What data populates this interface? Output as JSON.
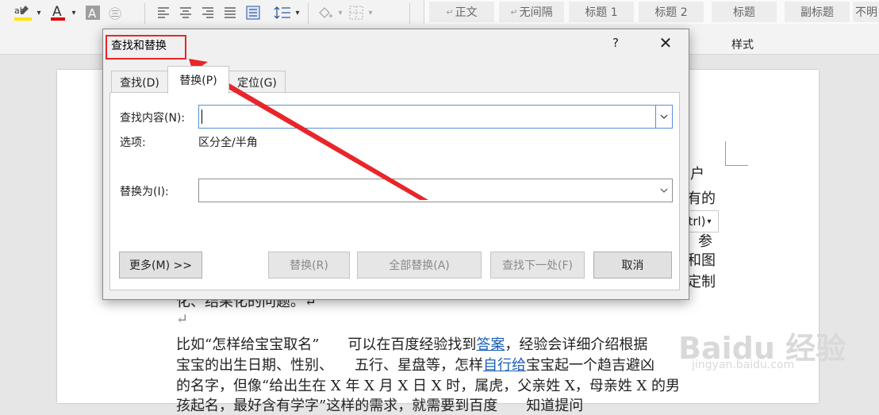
{
  "ribbon": {
    "styles": [
      "正文",
      "无间隔",
      "标题 1",
      "标题 2",
      "标题",
      "副标题",
      "不明"
    ],
    "styles_group_label": "样式",
    "handwriting_glyph": "㊂"
  },
  "document": {
    "lines": [
      {
        "text": "户"
      },
      {
        "text": "有的"
      },
      {
        "text": "参"
      },
      {
        "text": "和图"
      },
      {
        "text": "定制"
      },
      {
        "text": "化、结果化的问题。↵"
      },
      {
        "text": "↵"
      },
      {
        "pre": "比如“怎样给宝宝取名”　　可以在百度经验找到",
        "link": "答案",
        "post": "，经验会详细介绍根据"
      },
      {
        "pre": "宝宝的出生日期、性别、　　五行、星盘等，怎样",
        "link": "自行给",
        "post": "宝宝起一个趋吉避凶"
      },
      {
        "text": "的名字，但像“给出生在 X 年 X 月 X 日 X 时，属虎，父亲姓 X，母亲姓 X 的男"
      },
      {
        "text": "孩起名，最好含有学字”这样的需求，就需要到百度　　知道提问"
      }
    ],
    "paste_tag": "trl)",
    "watermark": "Baidu 经验",
    "watermark_url": "jingyan.baidu.com"
  },
  "dialog": {
    "title": "查找和替换",
    "help": "?",
    "close": "✕",
    "tabs": [
      {
        "label": "查找(D)"
      },
      {
        "label": "替换(P)"
      },
      {
        "label": "定位(G)"
      }
    ],
    "find_label": "查找内容(N):",
    "find_value": "",
    "options_label": "选项:",
    "options_value": "区分全/半角",
    "replace_label": "替换为(I):",
    "replace_value": "",
    "buttons": {
      "more": "更多(M) >>",
      "replace": "替换(R)",
      "replace_all": "全部替换(A)",
      "find_next": "查找下一处(F)",
      "cancel": "取消"
    }
  },
  "colors": {
    "annotation": "#e8262a",
    "link": "#1a5fb4",
    "highlight_yellow": "#ffe600",
    "font_red": "#e00000"
  }
}
